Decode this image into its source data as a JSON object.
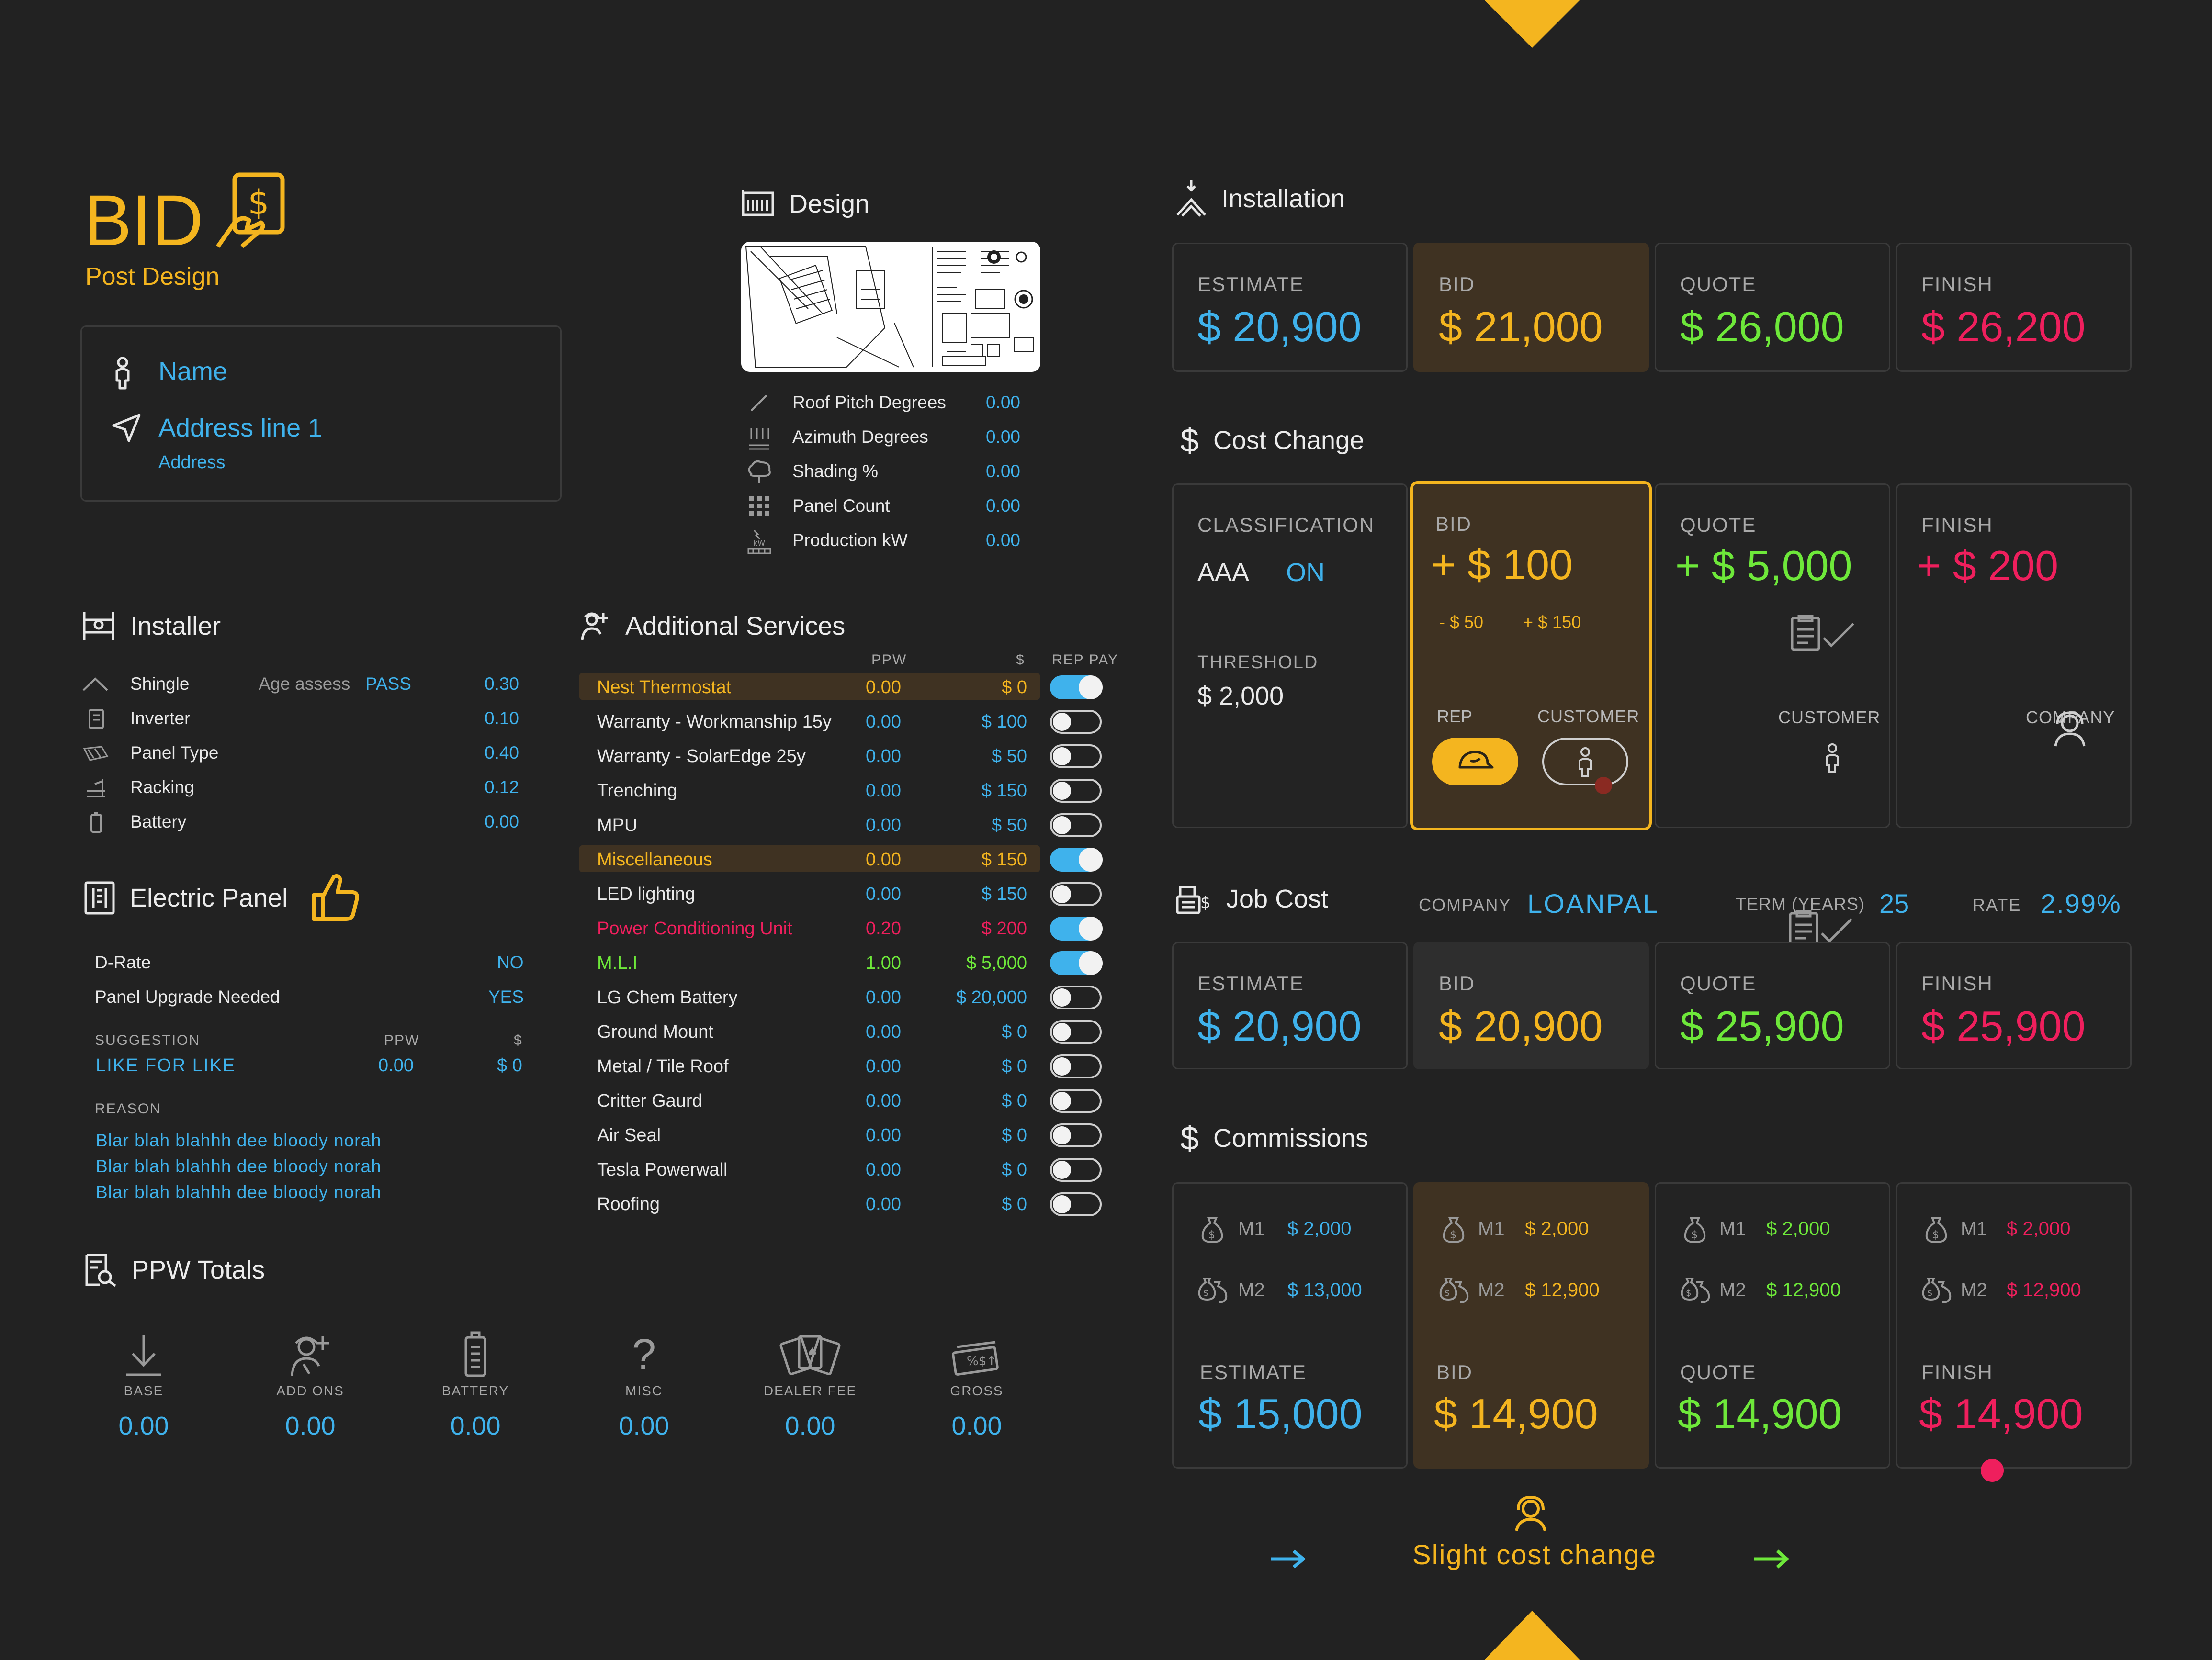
{
  "header": {
    "title": "BID",
    "subtitle": "Post Design"
  },
  "customer": {
    "name": "Name",
    "address_line": "Address line 1",
    "address_label": "Address"
  },
  "design": {
    "title": "Design",
    "params": [
      {
        "label": "Roof Pitch Degrees",
        "value": "0.00",
        "icon": "pitch-icon"
      },
      {
        "label": "Azimuth Degrees",
        "value": "0.00",
        "icon": "azimuth-icon"
      },
      {
        "label": "Shading %",
        "value": "0.00",
        "icon": "tree-icon"
      },
      {
        "label": "Panel Count",
        "value": "0.00",
        "icon": "grid-icon"
      },
      {
        "label": "Production kW",
        "value": "0.00",
        "icon": "production-icon"
      }
    ]
  },
  "installation": {
    "title": "Installation",
    "cards": [
      {
        "label": "ESTIMATE",
        "value": "$ 20,900",
        "color": "#3fb2ec"
      },
      {
        "label": "BID",
        "value": "$ 21,000",
        "color": "#f4b51f"
      },
      {
        "label": "QUOTE",
        "value": "$ 26,000",
        "color": "#6ee83a"
      },
      {
        "label": "FINISH",
        "value": "$ 26,200",
        "color": "#ef1f5d"
      }
    ]
  },
  "cost_change": {
    "title": "Cost Change",
    "classification_label": "CLASSIFICATION",
    "classification_value": "AAA",
    "classification_status": "ON",
    "threshold_label": "THRESHOLD",
    "threshold_value": "$ 2,000",
    "bid_label": "BID",
    "bid_value": "+ $ 100",
    "bid_minus": "- $ 50",
    "bid_plus": "+ $ 150",
    "rep_label": "REP",
    "customer_label": "CUSTOMER",
    "quote_label": "QUOTE",
    "quote_value": "+ $ 5,000",
    "quote_who": "CUSTOMER",
    "finish_label": "FINISH",
    "finish_value": "+ $ 200",
    "finish_who": "COMPANY"
  },
  "job_cost": {
    "title": "Job Cost",
    "company_label": "COMPANY",
    "company_value": "LOANPAL",
    "term_label": "TERM (YEARS)",
    "term_value": "25",
    "rate_label": "RATE",
    "rate_value": "2.99%",
    "cards": [
      {
        "label": "ESTIMATE",
        "value": "$ 20,900"
      },
      {
        "label": "BID",
        "value": "$ 20,900"
      },
      {
        "label": "QUOTE",
        "value": "$ 25,900"
      },
      {
        "label": "FINISH",
        "value": "$ 25,900"
      }
    ]
  },
  "commissions": {
    "title": "Commissions",
    "m1_label": "M1",
    "m2_label": "M2",
    "cards": [
      {
        "m1": "$ 2,000",
        "m2": "$ 13,000",
        "label": "ESTIMATE",
        "value": "$ 15,000"
      },
      {
        "m1": "$ 2,000",
        "m2": "$ 12,900",
        "label": "BID",
        "value": "$ 14,900"
      },
      {
        "m1": "$ 2,000",
        "m2": "$ 12,900",
        "label": "QUOTE",
        "value": "$ 14,900"
      },
      {
        "m1": "$ 2,000",
        "m2": "$ 12,900",
        "label": "FINISH",
        "value": "$ 14,900"
      }
    ],
    "footer_text": "Slight cost change"
  },
  "installer": {
    "title": "Installer",
    "age_assess_label": "Age assess",
    "age_assess_value": "PASS",
    "items": [
      {
        "label": "Shingle",
        "value": "0.30"
      },
      {
        "label": "Inverter",
        "value": "0.10"
      },
      {
        "label": "Panel Type",
        "value": "0.40"
      },
      {
        "label": "Racking",
        "value": "0.12"
      },
      {
        "label": "Battery",
        "value": "0.00"
      }
    ]
  },
  "electric_panel": {
    "title": "Electric Panel",
    "rows": [
      {
        "label": "D-Rate",
        "value": "NO"
      },
      {
        "label": "Panel Upgrade Needed",
        "value": "YES"
      }
    ],
    "suggestion_label": "SUGGESTION",
    "ppw_label": "PPW",
    "dollar_label": "$",
    "suggestion_value": "LIKE FOR LIKE",
    "suggestion_ppw": "0.00",
    "suggestion_dollar": "$ 0",
    "reason_label": "REASON",
    "reasons": [
      "Blar blah blahhh dee bloody norah",
      "Blar blah blahhh dee bloody norah",
      "Blar blah blahhh dee bloody norah"
    ]
  },
  "additional_services": {
    "title": "Additional Services",
    "col_ppw": "PPW",
    "col_dollar": "$",
    "col_rep_pay": "REP PAY",
    "items": [
      {
        "label": "Nest Thermostat",
        "ppw": "0.00",
        "cost": "$ 0",
        "on": true,
        "style": "highlight"
      },
      {
        "label": "Warranty - Workmanship 15y",
        "ppw": "0.00",
        "cost": "$ 100",
        "on": false,
        "style": "normal"
      },
      {
        "label": "Warranty - SolarEdge 25y",
        "ppw": "0.00",
        "cost": "$ 50",
        "on": false,
        "style": "normal"
      },
      {
        "label": "Trenching",
        "ppw": "0.00",
        "cost": "$ 150",
        "on": false,
        "style": "normal"
      },
      {
        "label": "MPU",
        "ppw": "0.00",
        "cost": "$ 50",
        "on": false,
        "style": "normal"
      },
      {
        "label": "Miscellaneous",
        "ppw": "0.00",
        "cost": "$ 150",
        "on": true,
        "style": "highlight"
      },
      {
        "label": "LED lighting",
        "ppw": "0.00",
        "cost": "$ 150",
        "on": false,
        "style": "normal"
      },
      {
        "label": "Power Conditioning Unit",
        "ppw": "0.20",
        "cost": "$ 200",
        "on": true,
        "style": "red"
      },
      {
        "label": "M.L.I",
        "ppw": "1.00",
        "cost": "$ 5,000",
        "on": true,
        "style": "green"
      },
      {
        "label": "LG Chem Battery",
        "ppw": "0.00",
        "cost": "$ 20,000",
        "on": false,
        "style": "normal"
      },
      {
        "label": "Ground Mount",
        "ppw": "0.00",
        "cost": "$ 0",
        "on": false,
        "style": "normal"
      },
      {
        "label": "Metal / Tile Roof",
        "ppw": "0.00",
        "cost": "$ 0",
        "on": false,
        "style": "normal"
      },
      {
        "label": "Critter Gaurd",
        "ppw": "0.00",
        "cost": "$ 0",
        "on": false,
        "style": "normal"
      },
      {
        "label": "Air Seal",
        "ppw": "0.00",
        "cost": "$ 0",
        "on": false,
        "style": "normal"
      },
      {
        "label": "Tesla Powerwall",
        "ppw": "0.00",
        "cost": "$ 0",
        "on": false,
        "style": "normal"
      },
      {
        "label": "Roofing",
        "ppw": "0.00",
        "cost": "$ 0",
        "on": false,
        "style": "normal"
      }
    ]
  },
  "ppw_totals": {
    "title": "PPW Totals",
    "items": [
      {
        "label": "BASE",
        "value": "0.00",
        "icon": "download-icon"
      },
      {
        "label": "ADD ONS",
        "value": "0.00",
        "icon": "add-person-icon"
      },
      {
        "label": "BATTERY",
        "value": "0.00",
        "icon": "battery-icon"
      },
      {
        "label": "MISC",
        "value": "0.00",
        "icon": "question-icon"
      },
      {
        "label": "DEALER FEE",
        "value": "0.00",
        "icon": "cards-icon"
      },
      {
        "label": "GROSS",
        "value": "0.00",
        "icon": "cash-icon"
      }
    ]
  },
  "colors": {
    "background": "#222222",
    "accent_yellow": "#f4b51f",
    "blue": "#3fb2ec",
    "green": "#6ee83a",
    "red": "#ef1f5d",
    "bid_card": "#3f3222"
  }
}
